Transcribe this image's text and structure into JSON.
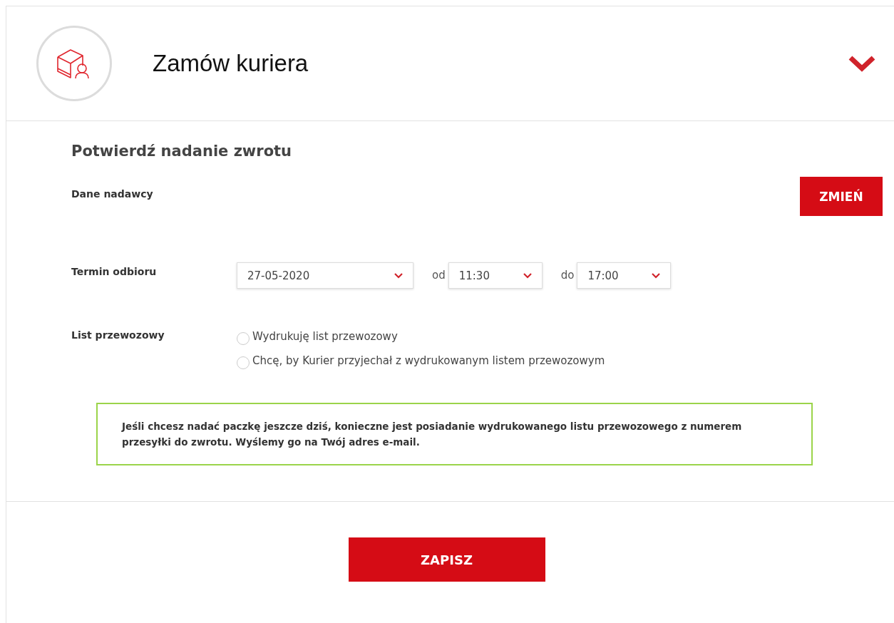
{
  "header": {
    "title": "Zamów kuriera",
    "expanded": true
  },
  "form": {
    "heading": "Potwierdź nadanie zwrotu",
    "sender": {
      "label": "Dane nadawcy",
      "button": "ZMIEŃ"
    },
    "pickup": {
      "label": "Termin odbioru",
      "date": "27-05-2020",
      "from_label": "od",
      "from": "11:30",
      "to_label": "do",
      "to": "17:00"
    },
    "waybill": {
      "label": "List przewozowy",
      "options": [
        {
          "label": "Wydrukuję list przewozowy",
          "selected": false
        },
        {
          "label": "Chcę, by Kurier przyjechał z wydrukowanym listem przewozowym",
          "selected": false
        }
      ]
    },
    "notice": "Jeśli chcesz nadać paczkę jeszcze dziś, konieczne jest posiadanie wydrukowanego listu przewozowego z numerem przesyłki do zwrotu. Wyślemy go na Twój adres e-mail."
  },
  "footer": {
    "button": "ZAPISZ"
  }
}
